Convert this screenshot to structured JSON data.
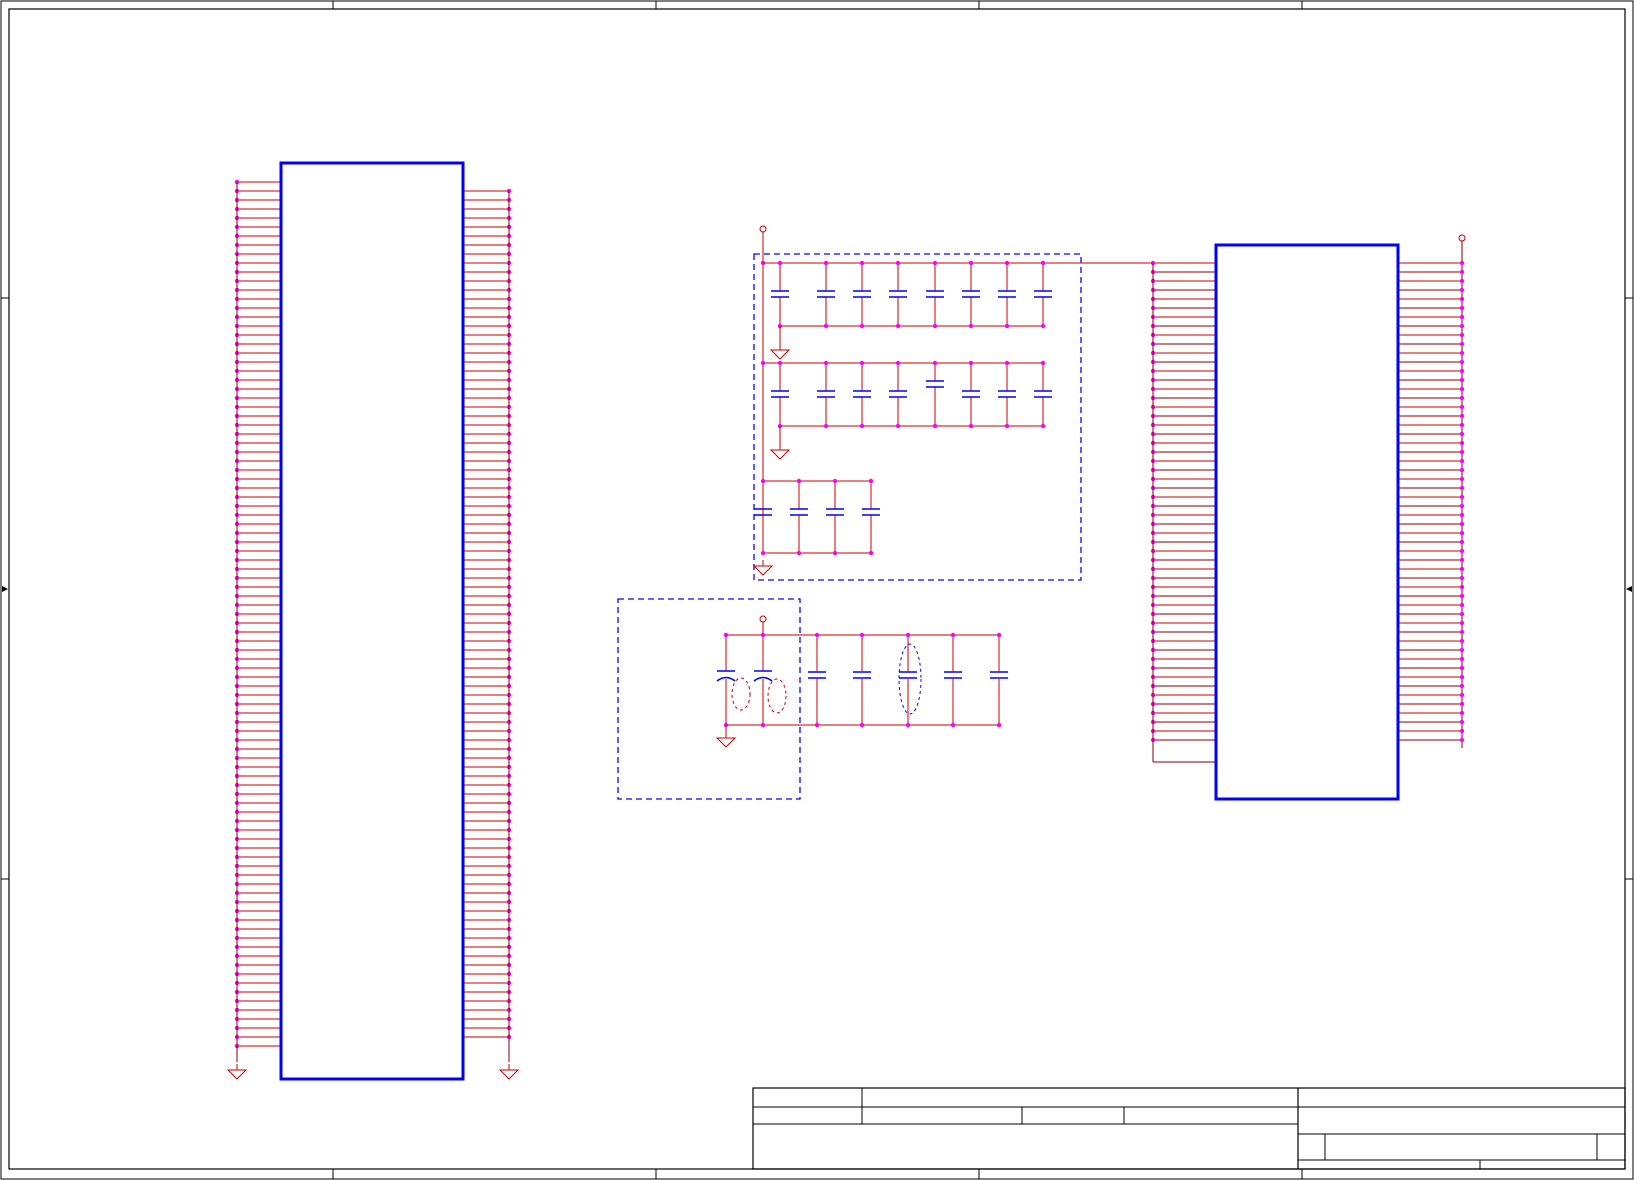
{
  "sheet": {
    "title": "",
    "colors": {
      "frame": "#000000",
      "wire": "#cc0000",
      "junction": "#ff00ff",
      "component": "#0000ff",
      "bus": "#1000ff",
      "stub": "#880000",
      "background": "#ffffff"
    }
  },
  "components": {
    "left_ic": {
      "label": ""
    },
    "right_ic": {
      "label": ""
    },
    "decoupling_group_1": {
      "label": ""
    },
    "decoupling_group_2": {
      "label": ""
    }
  },
  "title_block": {
    "title": "",
    "size": "",
    "document_number": "",
    "revision": "",
    "date": "",
    "sheet": ""
  }
}
